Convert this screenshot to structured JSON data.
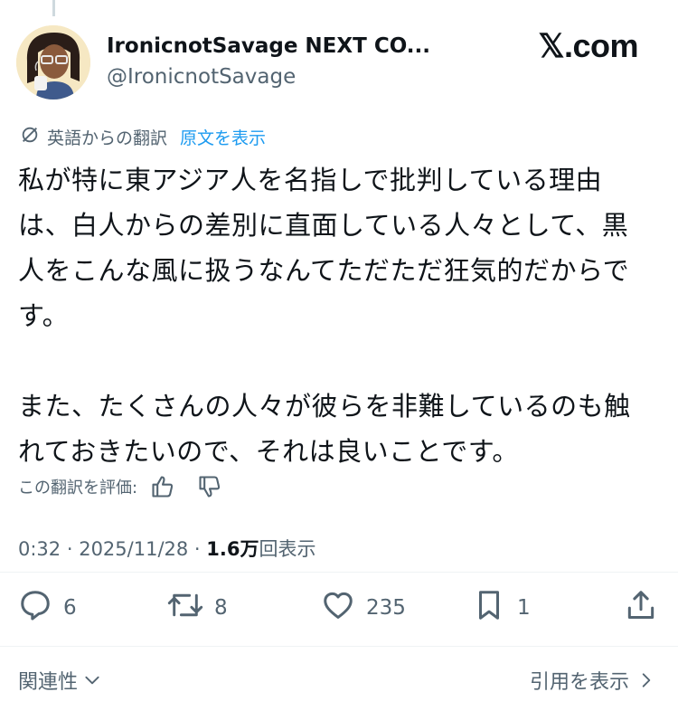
{
  "author": {
    "display_name": "IronicnotSavage NEXT CO...",
    "handle": "@IronicnotSavage",
    "avatar_icon": "avatar-illustration-icon"
  },
  "brand": {
    "label": "𝕏.com"
  },
  "translation": {
    "icon": "translate-icon",
    "translated_label": "英語からの翻訳",
    "show_original_label": "原文を表示",
    "link_color": "#1d9bf0"
  },
  "tweet": {
    "text": "私が特に東アジア人を名指しで批判している理由は、白人からの差別に直面している人々として、黒人をこんな風に扱うなんてただただ狂気的だからです。\n\nまた、たくさんの人々が彼らを非難しているのも触れておきたいので、それは良いことです。"
  },
  "rate_translation": {
    "label": "この翻訳を評価:",
    "thumbs_up_icon": "thumbs-up-icon",
    "thumbs_down_icon": "thumbs-down-icon"
  },
  "meta": {
    "time": "0:32",
    "separator": " · ",
    "date": "2025/11/28",
    "views_count": "1.6万",
    "views_label": "回表示"
  },
  "actions": {
    "reply_count": "6",
    "retweet_count": "8",
    "like_count": "235",
    "bookmark_count": "1",
    "share_icon": "share-icon"
  },
  "footer": {
    "related_label": "関連性",
    "quotes_label": "引用を表示"
  },
  "colors": {
    "text_primary": "#0f1419",
    "text_secondary": "#536471",
    "divider": "#eff3f4"
  }
}
